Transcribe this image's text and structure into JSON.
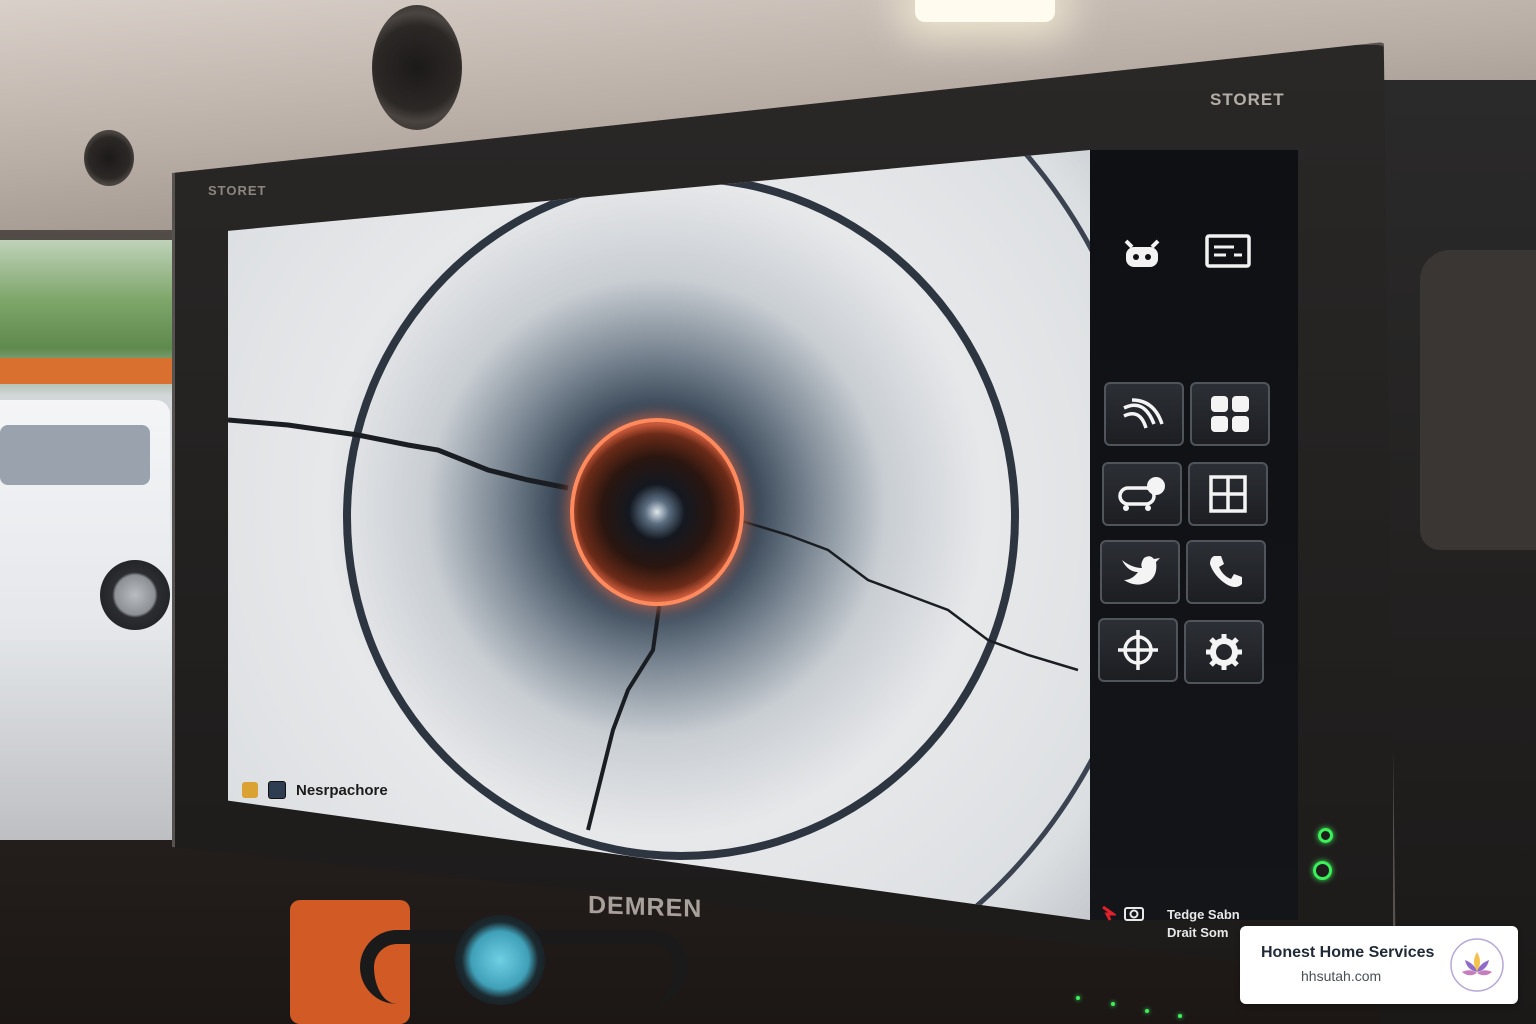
{
  "monitor": {
    "brand_top_right": "STORET",
    "brand_top_left": "STORET",
    "brand_bottom": "DEMREN"
  },
  "screen": {
    "status_label": "Nesrpachore",
    "footer_line1": "Tedge Sabn",
    "footer_line2": "Drait Som"
  },
  "side_panel": {
    "top_icons": [
      "robot-icon",
      "display-icon"
    ],
    "tiles": [
      "pipe-bend-icon",
      "grid-blocks-icon",
      "crawler-camera-icon",
      "window-grid-icon",
      "bird-icon",
      "phone-icon",
      "crosshair-icon",
      "gear-icon"
    ]
  },
  "watermark": {
    "title": "Honest Home Services",
    "url": "hhsutah.com"
  },
  "colors": {
    "accent_orange": "#ff8a5e",
    "led_green": "#3cf05a"
  }
}
